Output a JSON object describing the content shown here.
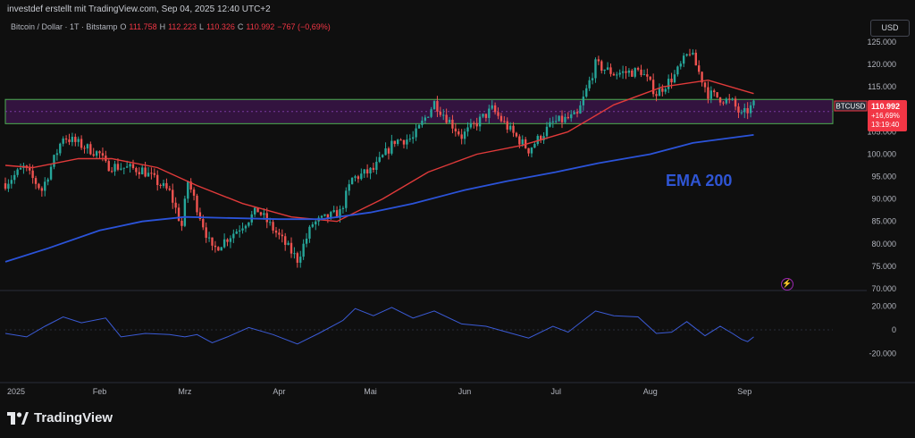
{
  "header": {
    "snapshot_text": "investdef erstellt mit TradingView.com, Sep 04, 2025 12:40 UTC+2"
  },
  "legend": {
    "symbol": "Bitcoin / Dollar · 1T · Bitstamp",
    "open_label": "O",
    "open": "111.758",
    "high_label": "H",
    "high": "112.223",
    "low_label": "L",
    "low": "110.326",
    "close_label": "C",
    "close": "110.992",
    "change": "−767 (−0,69%)"
  },
  "toolbar": {
    "currency": "USD"
  },
  "price_badge": {
    "ticker": "BTCUSD",
    "price": "110.992",
    "change_pct": "+16,69%",
    "countdown": "13:19:40"
  },
  "annotation": "EMA 200",
  "branding": {
    "logo_text": "TradingView"
  },
  "colors": {
    "up": "#26a69a",
    "down": "#ef5350",
    "ema_short": "#e03a3a",
    "ema_200": "#2b53d9",
    "oscillator": "#3b5bd6",
    "zone_fill": "#3a1448",
    "zone_border": "#4caf50",
    "badge": "#f23645",
    "annotation": "#2f55d4"
  },
  "chart_data": {
    "type": "candlestick",
    "y_ticks": [
      "125.000",
      "120.000",
      "115.000",
      "110.000",
      "105.000",
      "100.000",
      "95.000",
      "90.000",
      "85.000",
      "80.000",
      "75.000",
      "70.000"
    ],
    "y_range": [
      70000,
      125000
    ],
    "x_ticks": [
      {
        "label": "2025",
        "date": "2025-01-01"
      },
      {
        "label": "Feb",
        "date": "2025-02-01"
      },
      {
        "label": "Mrz",
        "date": "2025-03-01"
      },
      {
        "label": "Apr",
        "date": "2025-04-01"
      },
      {
        "label": "Mai",
        "date": "2025-05-01"
      },
      {
        "label": "Jun",
        "date": "2025-06-01"
      },
      {
        "label": "Jul",
        "date": "2025-07-01"
      },
      {
        "label": "Aug",
        "date": "2025-08-01"
      },
      {
        "label": "Sep",
        "date": "2025-09-01"
      }
    ],
    "x_range": [
      "2025-01-01",
      "2025-09-30"
    ],
    "last_date": "2025-09-04",
    "price_path": [
      [
        "2025-01-01",
        93500
      ],
      [
        "2025-01-07",
        97000
      ],
      [
        "2025-01-13",
        92000
      ],
      [
        "2025-01-20",
        104000
      ],
      [
        "2025-01-26",
        102000
      ],
      [
        "2025-02-01",
        100000
      ],
      [
        "2025-02-03",
        97500
      ],
      [
        "2025-02-15",
        96500
      ],
      [
        "2025-02-24",
        91500
      ],
      [
        "2025-02-28",
        84000
      ],
      [
        "2025-03-02",
        94000
      ],
      [
        "2025-03-10",
        78500
      ],
      [
        "2025-03-18",
        83000
      ],
      [
        "2025-03-25",
        87500
      ],
      [
        "2025-03-31",
        82500
      ],
      [
        "2025-04-07",
        76500
      ],
      [
        "2025-04-12",
        84500
      ],
      [
        "2025-04-21",
        87000
      ],
      [
        "2025-04-25",
        94500
      ],
      [
        "2025-05-02",
        96500
      ],
      [
        "2025-05-09",
        103000
      ],
      [
        "2025-05-15",
        103500
      ],
      [
        "2025-05-22",
        111500
      ],
      [
        "2025-05-31",
        104000
      ],
      [
        "2025-06-10",
        110000
      ],
      [
        "2025-06-17",
        104500
      ],
      [
        "2025-06-22",
        101000
      ],
      [
        "2025-06-30",
        107000
      ],
      [
        "2025-07-08",
        108500
      ],
      [
        "2025-07-14",
        120000
      ],
      [
        "2025-07-20",
        118000
      ],
      [
        "2025-07-29",
        118500
      ],
      [
        "2025-08-03",
        113500
      ],
      [
        "2025-08-09",
        117500
      ],
      [
        "2025-08-14",
        123000
      ],
      [
        "2025-08-20",
        113500
      ],
      [
        "2025-08-28",
        111500
      ],
      [
        "2025-08-31",
        108500
      ],
      [
        "2025-09-04",
        110992
      ]
    ],
    "ema_short": [
      [
        "2025-01-01",
        97500
      ],
      [
        "2025-01-10",
        97000
      ],
      [
        "2025-01-25",
        99000
      ],
      [
        "2025-02-05",
        99000
      ],
      [
        "2025-02-20",
        97000
      ],
      [
        "2025-03-05",
        93000
      ],
      [
        "2025-03-20",
        89000
      ],
      [
        "2025-04-05",
        86000
      ],
      [
        "2025-04-20",
        85000
      ],
      [
        "2025-05-05",
        90000
      ],
      [
        "2025-05-20",
        96000
      ],
      [
        "2025-06-05",
        100000
      ],
      [
        "2025-06-20",
        102000
      ],
      [
        "2025-07-05",
        105000
      ],
      [
        "2025-07-20",
        111000
      ],
      [
        "2025-08-05",
        115000
      ],
      [
        "2025-08-20",
        116500
      ],
      [
        "2025-09-04",
        113500
      ]
    ],
    "ema_200": [
      [
        "2025-01-01",
        76000
      ],
      [
        "2025-01-15",
        79000
      ],
      [
        "2025-02-01",
        83000
      ],
      [
        "2025-02-15",
        85000
      ],
      [
        "2025-03-01",
        86000
      ],
      [
        "2025-04-01",
        85500
      ],
      [
        "2025-04-15",
        85500
      ],
      [
        "2025-05-01",
        87000
      ],
      [
        "2025-05-15",
        89000
      ],
      [
        "2025-06-01",
        92000
      ],
      [
        "2025-06-15",
        94000
      ],
      [
        "2025-07-01",
        96000
      ],
      [
        "2025-07-15",
        98000
      ],
      [
        "2025-08-01",
        100000
      ],
      [
        "2025-08-15",
        102500
      ],
      [
        "2025-09-04",
        104300
      ]
    ],
    "support_zone": {
      "low": 106800,
      "high": 112200,
      "end_date": "2025-09-30"
    },
    "oscillator": {
      "y_ticks": [
        "20.000",
        "0",
        "-20.000"
      ],
      "y_range": [
        -25000,
        25000
      ],
      "points": [
        [
          "2025-01-01",
          -3000
        ],
        [
          "2025-01-08",
          -6000
        ],
        [
          "2025-01-14",
          3000
        ],
        [
          "2025-01-20",
          11000
        ],
        [
          "2025-01-26",
          6000
        ],
        [
          "2025-02-03",
          10000
        ],
        [
          "2025-02-08",
          -6000
        ],
        [
          "2025-02-16",
          -3000
        ],
        [
          "2025-02-24",
          -4000
        ],
        [
          "2025-03-01",
          -6000
        ],
        [
          "2025-03-05",
          -4000
        ],
        [
          "2025-03-10",
          -11000
        ],
        [
          "2025-03-15",
          -6000
        ],
        [
          "2025-03-22",
          2000
        ],
        [
          "2025-03-30",
          -4000
        ],
        [
          "2025-04-07",
          -12000
        ],
        [
          "2025-04-14",
          -3000
        ],
        [
          "2025-04-22",
          8000
        ],
        [
          "2025-04-26",
          18000
        ],
        [
          "2025-05-02",
          12000
        ],
        [
          "2025-05-08",
          19000
        ],
        [
          "2025-05-15",
          10000
        ],
        [
          "2025-05-22",
          16000
        ],
        [
          "2025-05-31",
          5000
        ],
        [
          "2025-06-08",
          3000
        ],
        [
          "2025-06-15",
          -2000
        ],
        [
          "2025-06-22",
          -7000
        ],
        [
          "2025-06-30",
          3000
        ],
        [
          "2025-07-05",
          -2000
        ],
        [
          "2025-07-10",
          8000
        ],
        [
          "2025-07-14",
          16000
        ],
        [
          "2025-07-20",
          12000
        ],
        [
          "2025-07-28",
          11000
        ],
        [
          "2025-08-03",
          -3000
        ],
        [
          "2025-08-08",
          -2000
        ],
        [
          "2025-08-13",
          7000
        ],
        [
          "2025-08-19",
          -5000
        ],
        [
          "2025-08-24",
          3000
        ],
        [
          "2025-08-28",
          -3000
        ],
        [
          "2025-08-31",
          -8000
        ],
        [
          "2025-09-02",
          -10000
        ],
        [
          "2025-09-04",
          -6000
        ]
      ]
    }
  }
}
